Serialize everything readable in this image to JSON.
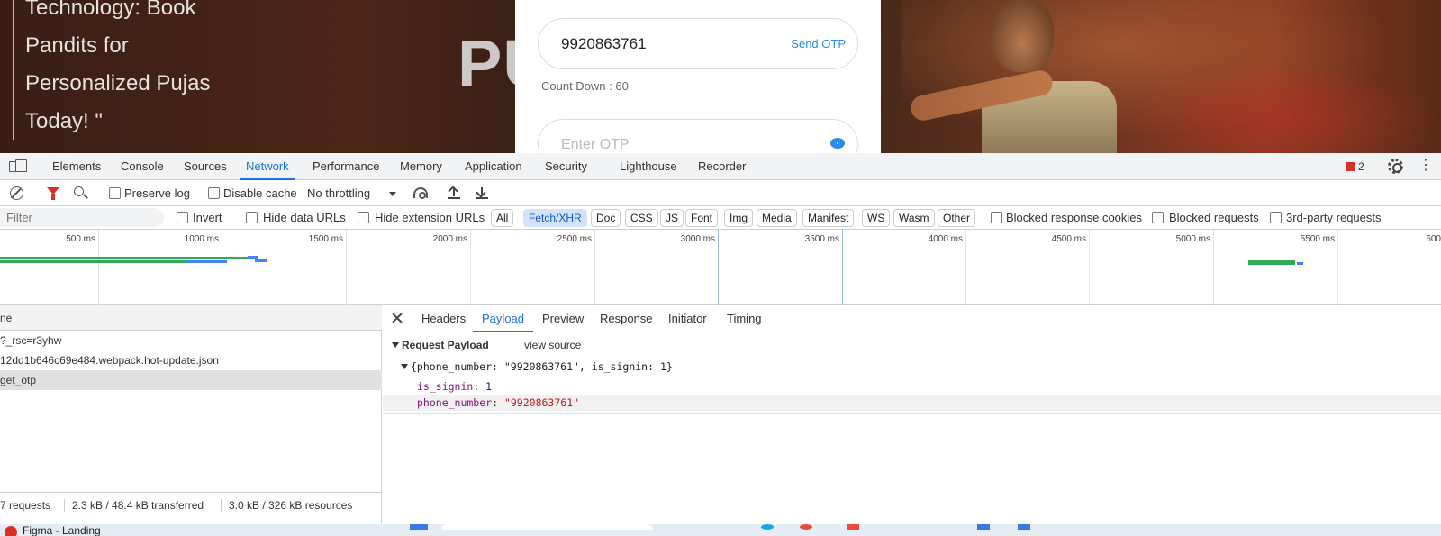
{
  "page": {
    "quote_lines": [
      "Technology: Book",
      "Pandits for",
      "Personalized Pujas",
      "Today! \""
    ],
    "background_title": "PU          AR",
    "login": {
      "phone_value": "9920863761",
      "send_otp_label": "Send OTP",
      "countdown": "Count Down : 60",
      "otp_placeholder": "Enter OTP"
    }
  },
  "devtools": {
    "tabs": [
      {
        "label": "Elements"
      },
      {
        "label": "Console"
      },
      {
        "label": "Sources"
      },
      {
        "label": "Network"
      },
      {
        "label": "Performance"
      },
      {
        "label": "Memory"
      },
      {
        "label": "Application"
      },
      {
        "label": "Security"
      },
      {
        "label": "Lighthouse"
      },
      {
        "label": "Recorder"
      }
    ],
    "active_tab": "Network",
    "error_count": "2",
    "toolbar": {
      "preserve_log": "Preserve log",
      "disable_cache": "Disable cache",
      "throttling": "No throttling"
    },
    "filter": {
      "placeholder": "Filter",
      "invert": "Invert",
      "hide_data_urls": "Hide data URLs",
      "hide_extension_urls": "Hide extension URLs",
      "types": [
        "All",
        "Fetch/XHR",
        "Doc",
        "CSS",
        "JS",
        "Font",
        "Img",
        "Media",
        "Manifest",
        "WS",
        "Wasm",
        "Other"
      ],
      "active_type": "Fetch/XHR",
      "blocked_response_cookies": "Blocked response cookies",
      "blocked_requests": "Blocked requests",
      "third_party": "3rd-party requests"
    },
    "timeline": {
      "ticks": [
        "500 ms",
        "1000 ms",
        "1500 ms",
        "2000 ms",
        "2500 ms",
        "3000 ms",
        "3500 ms",
        "4000 ms",
        "4500 ms",
        "5000 ms",
        "5500 ms",
        "600"
      ]
    },
    "requests": {
      "column_header": "ne",
      "rows": [
        {
          "name": "?_rsc=r3yhw"
        },
        {
          "name": "12dd1b646c69e484.webpack.hot-update.json"
        },
        {
          "name": "get_otp"
        }
      ],
      "selected": "get_otp",
      "status": {
        "requests": "7 requests",
        "transferred": "2.3 kB / 48.4 kB transferred",
        "resources": "3.0 kB / 326 kB resources"
      }
    },
    "detail": {
      "tabs": [
        "Headers",
        "Payload",
        "Preview",
        "Response",
        "Initiator",
        "Timing"
      ],
      "active_tab": "Payload",
      "payload_title": "Request Payload",
      "view_source": "view source",
      "object_summary": "{phone_number: \"9920863761\", is_signin: 1}",
      "props": [
        {
          "key": "is_signin",
          "value": "1",
          "kind": "number"
        },
        {
          "key": "phone_number",
          "value": "\"9920863761\"",
          "kind": "string"
        }
      ]
    }
  },
  "taskbar": {
    "text": "Figma - Landing"
  },
  "colors": {
    "accent": "#1a73e8",
    "error": "#d93025",
    "link": "#2c8ae8"
  }
}
